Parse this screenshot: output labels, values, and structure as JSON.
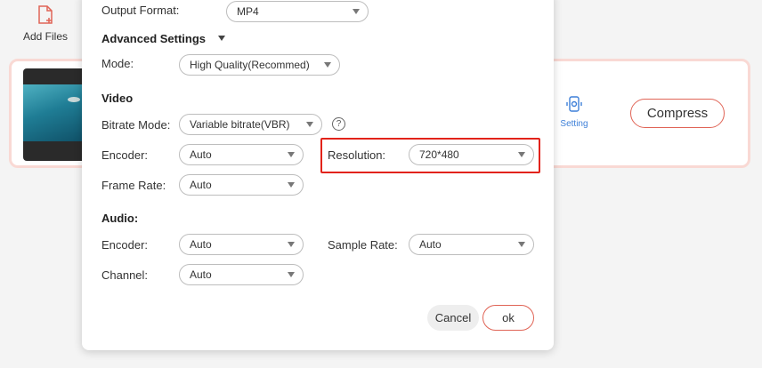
{
  "toolbar": {
    "add_files_label": "Add Files"
  },
  "file_row": {
    "setting_label": "Setting",
    "compress_label": "Compress"
  },
  "dialog": {
    "output_format": {
      "label": "Output Format:",
      "value": "MP4"
    },
    "advanced_title": "Advanced Settings",
    "mode": {
      "label": "Mode:",
      "value": "High Quality(Recommed)"
    },
    "video": {
      "title": "Video",
      "bitrate_mode": {
        "label": "Bitrate Mode:",
        "value": "Variable bitrate(VBR)"
      },
      "help_glyph": "?",
      "encoder": {
        "label": "Encoder:",
        "value": "Auto"
      },
      "resolution": {
        "label": "Resolution:",
        "value": "720*480"
      },
      "frame_rate": {
        "label": "Frame Rate:",
        "value": "Auto"
      }
    },
    "audio": {
      "title": "Audio:",
      "encoder": {
        "label": "Encoder:",
        "value": "Auto"
      },
      "sample_rate": {
        "label": "Sample Rate:",
        "value": "Auto"
      },
      "channel": {
        "label": "Channel:",
        "value": "Auto"
      }
    },
    "cancel_label": "Cancel",
    "ok_label": "ok"
  },
  "colors": {
    "accent": "#e06456",
    "highlight": "#e2231a",
    "link": "#3d7fd8"
  }
}
